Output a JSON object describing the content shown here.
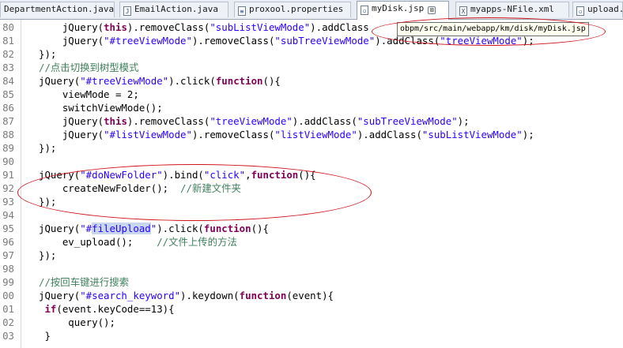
{
  "tabs": [
    {
      "label": "DepartmentAction.java",
      "icon": "java-file-icon",
      "active": false
    },
    {
      "label": "EmailAction.java",
      "icon": "java-file-icon",
      "active": false
    },
    {
      "label": "proxool.properties",
      "icon": "properties-file-icon",
      "active": false
    },
    {
      "label": "myDisk.jsp",
      "icon": "jsp-file-icon",
      "active": true,
      "close": "⊠"
    },
    {
      "label": "myapps-NFile.xml",
      "icon": "xml-file-icon",
      "active": false
    },
    {
      "label": "upload.",
      "icon": "jsp-file-icon",
      "active": false
    }
  ],
  "tooltip": "obpm/src/main/webapp/km/disk/myDisk.jsp",
  "annotation_color": "#d2141e",
  "lines": [
    {
      "n": "80",
      "code": "    jQuery(this).removeClass(\"subListViewMode\").addClass"
    },
    {
      "n": "81",
      "code": "    jQuery(\"#treeViewMode\").removeClass(\"subTreeViewMode\").addClass(\"treeViewMode\");"
    },
    {
      "n": "82",
      "code": "});"
    },
    {
      "n": "83",
      "code": "//点击切换到树型模式"
    },
    {
      "n": "84",
      "code": "jQuery(\"#treeViewMode\").click(function(){"
    },
    {
      "n": "85",
      "code": "    viewMode = 2;"
    },
    {
      "n": "86",
      "code": "    switchViewMode();"
    },
    {
      "n": "87",
      "code": "    jQuery(this).removeClass(\"treeViewMode\").addClass(\"subTreeViewMode\");"
    },
    {
      "n": "88",
      "code": "    jQuery(\"#listViewMode\").removeClass(\"listViewMode\").addClass(\"subListViewMode\");"
    },
    {
      "n": "89",
      "code": "});"
    },
    {
      "n": "90",
      "code": ""
    },
    {
      "n": "91",
      "code": "jQuery(\"#doNewFolder\").bind(\"click\",function(){"
    },
    {
      "n": "92",
      "code": "    createNewFolder();  //新建文件夹"
    },
    {
      "n": "93",
      "code": "});"
    },
    {
      "n": "94",
      "code": ""
    },
    {
      "n": "95",
      "code": "jQuery(\"#fileUpload\").click(function(){"
    },
    {
      "n": "96",
      "code": "    ev_upload();    //文件上传的方法"
    },
    {
      "n": "97",
      "code": "});"
    },
    {
      "n": "98",
      "code": ""
    },
    {
      "n": "99",
      "code": "//按回车键进行搜索"
    },
    {
      "n": "00",
      "code": "jQuery(\"#search_keyword\").keydown(function(event){"
    },
    {
      "n": "01",
      "code": " if(event.keyCode==13){"
    },
    {
      "n": "02",
      "code": "     query();"
    },
    {
      "n": "03",
      "code": " }"
    }
  ]
}
